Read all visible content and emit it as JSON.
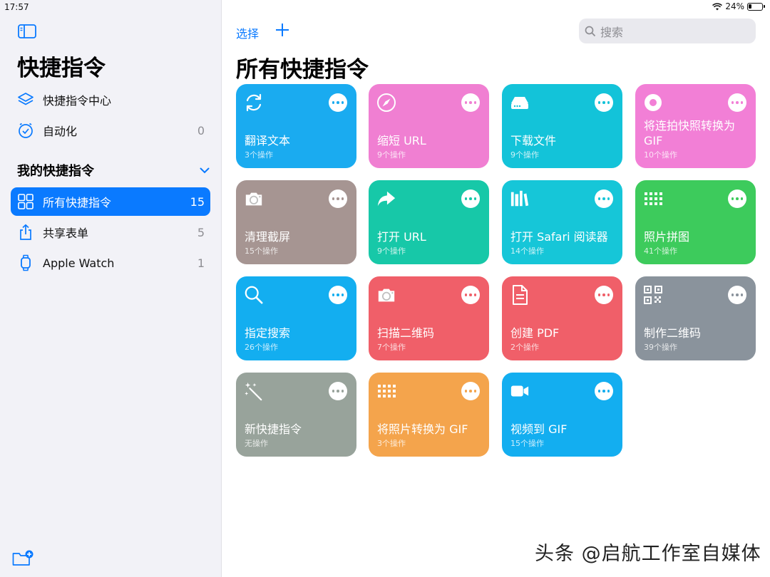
{
  "status": {
    "time": "17:57",
    "battery": "24%",
    "battery_level": 0.24
  },
  "sidebar": {
    "title": "快捷指令",
    "items": [
      {
        "label": "快捷指令中心",
        "count": ""
      },
      {
        "label": "自动化",
        "count": "0"
      }
    ],
    "section_label": "我的快捷指令",
    "folders": [
      {
        "label": "所有快捷指令",
        "count": "15"
      },
      {
        "label": "共享表单",
        "count": "5"
      },
      {
        "label": "Apple Watch",
        "count": "1"
      }
    ]
  },
  "toolbar": {
    "select_label": "选择",
    "search_placeholder": "搜索"
  },
  "main": {
    "title": "所有快捷指令",
    "cards": [
      {
        "name": "翻译文本",
        "sub": "3个操作",
        "color": "#1aabf0",
        "icon": "refresh-icon"
      },
      {
        "name": "缩短 URL",
        "sub": "9个操作",
        "color": "#f07fd2",
        "icon": "compass-icon"
      },
      {
        "name": "下载文件",
        "sub": "9个操作",
        "color": "#13c3d9",
        "icon": "drive-icon"
      },
      {
        "name": "将连拍快照转换为 GIF",
        "sub": "10个操作",
        "color": "#f27fd6",
        "icon": "burst-icon"
      },
      {
        "name": "清理截屏",
        "sub": "15个操作",
        "color": "#a69592",
        "icon": "camera-icon"
      },
      {
        "name": "打开 URL",
        "sub": "9个操作",
        "color": "#17c8a8",
        "icon": "share-arrow-icon"
      },
      {
        "name": "打开 Safari 阅读器",
        "sub": "14个操作",
        "color": "#16c6d8",
        "icon": "books-icon"
      },
      {
        "name": "照片拼图",
        "sub": "41个操作",
        "color": "#3dcb5c",
        "icon": "grid-icon"
      },
      {
        "name": "指定搜索",
        "sub": "26个操作",
        "color": "#13aef0",
        "icon": "magnifier-icon"
      },
      {
        "name": "扫描二维码",
        "sub": "7个操作",
        "color": "#f05f69",
        "icon": "camera-icon"
      },
      {
        "name": "创建 PDF",
        "sub": "2个操作",
        "color": "#f05f69",
        "icon": "document-icon"
      },
      {
        "name": "制作二维码",
        "sub": "39个操作",
        "color": "#8a939c",
        "icon": "qr-code-icon"
      },
      {
        "name": "新快捷指令",
        "sub": "无操作",
        "color": "#98a39b",
        "icon": "magic-wand-icon"
      },
      {
        "name": "将照片转换为 GIF",
        "sub": "3个操作",
        "color": "#f4a44c",
        "icon": "grid-icon"
      },
      {
        "name": "视频到 GIF",
        "sub": "15个操作",
        "color": "#13aef0",
        "icon": "video-icon"
      }
    ]
  },
  "watermark": "头条 @启航工作室自媒体"
}
